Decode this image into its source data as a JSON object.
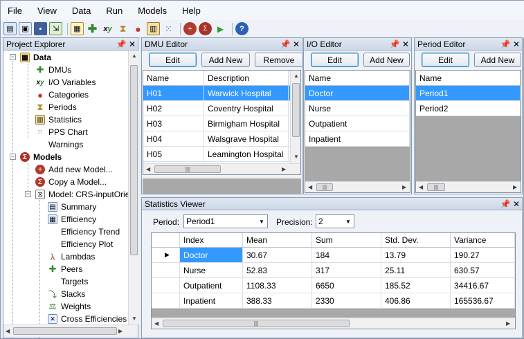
{
  "menu": [
    "File",
    "View",
    "Data",
    "Run",
    "Models",
    "Help"
  ],
  "toolbar_icons": [
    "new-project-icon",
    "open-icon",
    "save-icon",
    "import-icon",
    "dmu-icon",
    "add-icon",
    "xy-icon",
    "hourglass-icon",
    "categories-icon",
    "statistics-icon",
    "chart-icon",
    "add-model-icon",
    "run-model-icon",
    "play-icon",
    "help-icon"
  ],
  "project_explorer": {
    "title": "Project Explorer",
    "items": [
      {
        "label": "Data",
        "bold": true
      },
      {
        "label": "DMUs"
      },
      {
        "label": "I/O Variables"
      },
      {
        "label": "Categories"
      },
      {
        "label": "Periods"
      },
      {
        "label": "Statistics"
      },
      {
        "label": "PPS Chart"
      },
      {
        "label": "Warnings"
      },
      {
        "label": "Models",
        "bold": true
      },
      {
        "label": "Add new Model..."
      },
      {
        "label": "Copy a Model..."
      },
      {
        "label": "Model: CRS-inputOrie"
      },
      {
        "label": "Summary"
      },
      {
        "label": "Efficiency"
      },
      {
        "label": "Efficiency Trend"
      },
      {
        "label": "Efficiency Plot"
      },
      {
        "label": "Lambdas"
      },
      {
        "label": "Peers"
      },
      {
        "label": "Targets"
      },
      {
        "label": "Slacks"
      },
      {
        "label": "Weights"
      },
      {
        "label": "Cross Efficiencies"
      }
    ]
  },
  "dmu_editor": {
    "title": "DMU Editor",
    "buttons": [
      "Edit",
      "Add New",
      "Remove"
    ],
    "columns": [
      "Name",
      "Description"
    ],
    "rows": [
      [
        "H01",
        "Warwick Hospital"
      ],
      [
        "H02",
        "Coventry Hospital"
      ],
      [
        "H03",
        "Birmigham Hospital"
      ],
      [
        "H04",
        "Walsgrave Hospital"
      ],
      [
        "H05",
        "Leamington Hospital"
      ]
    ]
  },
  "io_editor": {
    "title": "I/O Editor",
    "buttons": [
      "Edit",
      "Add New"
    ],
    "columns": [
      "Name"
    ],
    "rows": [
      "Doctor",
      "Nurse",
      "Outpatient",
      "Inpatient"
    ]
  },
  "period_editor": {
    "title": "Period Editor",
    "buttons": [
      "Edit",
      "Add New"
    ],
    "columns": [
      "Name"
    ],
    "rows": [
      "Period1",
      "Period2"
    ]
  },
  "statistics_viewer": {
    "title": "Statistics Viewer",
    "period_label": "Period:",
    "period_value": "Period1",
    "precision_label": "Precision:",
    "precision_value": "2",
    "columns": [
      "Index",
      "Mean",
      "Sum",
      "Std. Dev.",
      "Variance"
    ],
    "rows": [
      [
        "Doctor",
        "30.67",
        "184",
        "13.79",
        "190.27"
      ],
      [
        "Nurse",
        "52.83",
        "317",
        "25.11",
        "630.57"
      ],
      [
        "Outpatient",
        "1108.33",
        "6650",
        "185.52",
        "34416.67"
      ],
      [
        "Inpatient",
        "388.33",
        "2330",
        "406.86",
        "165536.67"
      ]
    ]
  },
  "colors": {
    "selection": "#3399ff",
    "panel_title": "#cdd8e7"
  }
}
